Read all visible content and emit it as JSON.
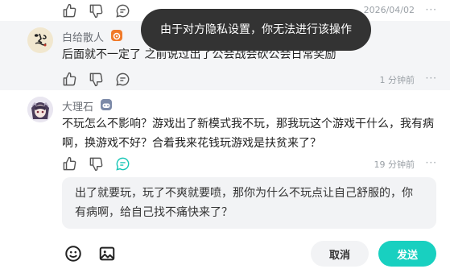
{
  "top_row": {
    "time": "2026/04/02",
    "more": "···"
  },
  "comments": [
    {
      "username": "白给散人",
      "badge_icon": "orange-level-badge-icon",
      "badge_color": "#f07a2a",
      "text": "后面就不一定了 之前说过出了公会战会砍公会日常奖励",
      "time": "1 分钟前",
      "more": "···"
    },
    {
      "username": "大理石",
      "badge_icon": "gamepad-badge-icon",
      "badge_color": "#7c8aa8",
      "text": "不玩怎么不影响？游戏出了新模式我不玩，那我玩这个游戏干什么，我有病啊，换游戏不好？合着我来花钱玩游戏是扶贫来了？",
      "time": "19 分钟前",
      "more": "···"
    }
  ],
  "reply": {
    "text": "出了就要玩，玩了不爽就要喷，那你为什么不玩点让自己舒服的，你有病啊，给自己找不痛快来了？"
  },
  "bottom_bar": {
    "emoji_icon": "emoji-icon",
    "image_icon": "image-icon",
    "cancel_label": "取消",
    "send_label": "发送",
    "send_color": "#18d0c0"
  },
  "toast": {
    "text": "由于对方隐私设置，你无法进行该操作"
  }
}
